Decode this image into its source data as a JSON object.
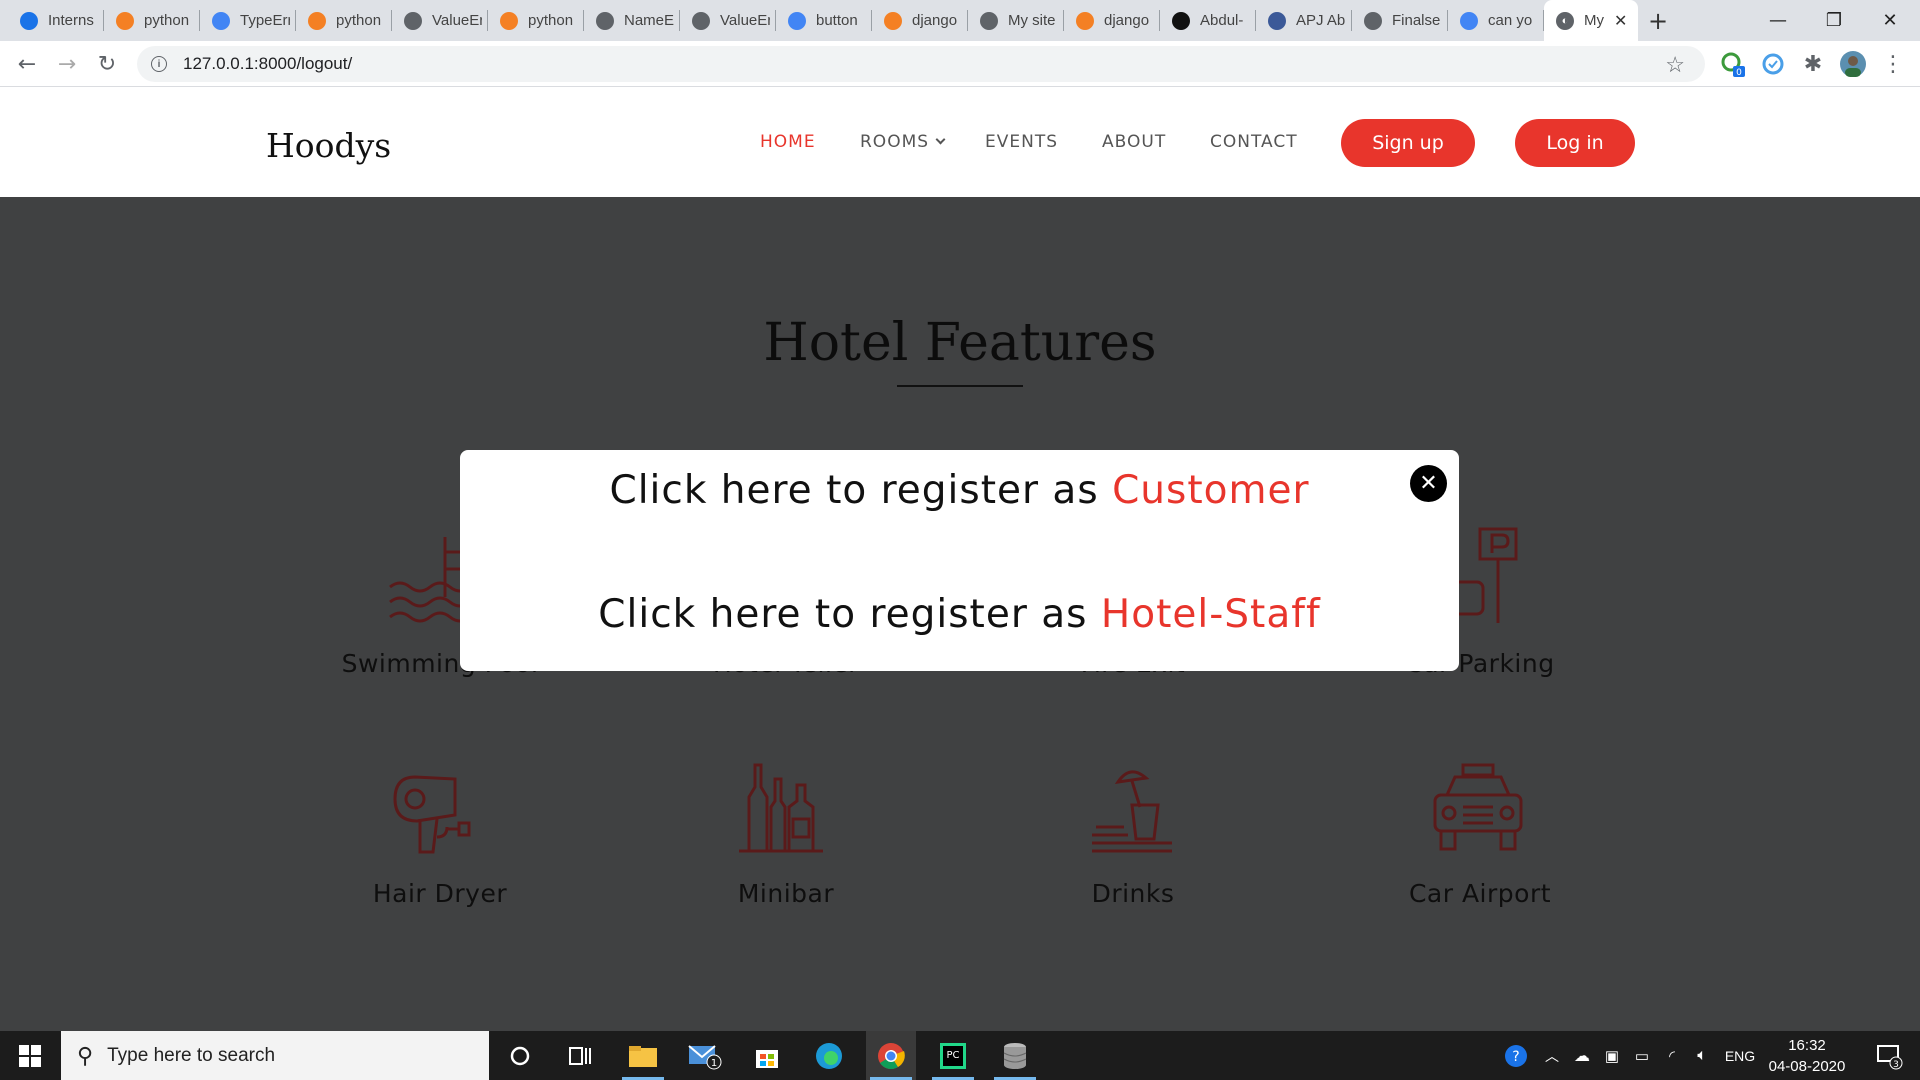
{
  "browser": {
    "tabs": [
      {
        "title": "Interns",
        "favicon": "is-icon",
        "color": "#1a73e8"
      },
      {
        "title": "python",
        "favicon": "stackoverflow-icon",
        "color": "#f48024"
      },
      {
        "title": "TypeErr",
        "favicon": "google-icon",
        "color": "#4285f4"
      },
      {
        "title": "python",
        "favicon": "stackoverflow-icon",
        "color": "#f48024"
      },
      {
        "title": "ValueEr",
        "favicon": "globe-icon",
        "color": "#5f6368"
      },
      {
        "title": "python",
        "favicon": "stackoverflow-icon",
        "color": "#f48024"
      },
      {
        "title": "NameE",
        "favicon": "globe-icon",
        "color": "#5f6368"
      },
      {
        "title": "ValueEr",
        "favicon": "globe-icon",
        "color": "#5f6368"
      },
      {
        "title": "button",
        "favicon": "google-icon",
        "color": "#4285f4"
      },
      {
        "title": "django",
        "favicon": "stackoverflow-icon",
        "color": "#f48024"
      },
      {
        "title": "My site",
        "favicon": "globe-icon",
        "color": "#5f6368"
      },
      {
        "title": "django",
        "favicon": "stackoverflow-icon",
        "color": "#f48024"
      },
      {
        "title": "Abdul-",
        "favicon": "github-icon",
        "color": "#111111"
      },
      {
        "title": "APJ Ab",
        "favicon": "shield-icon",
        "color": "#3b5998"
      },
      {
        "title": "Finalse",
        "favicon": "globe-icon",
        "color": "#5f6368"
      },
      {
        "title": "can yo",
        "favicon": "google-icon",
        "color": "#4285f4"
      }
    ],
    "active_tab": {
      "title": "My",
      "favicon": "globe-icon"
    },
    "url": "127.0.0.1:8000/logout/",
    "extension_badge": "0"
  },
  "site": {
    "brand": "Hoodys",
    "nav": {
      "home": "HOME",
      "rooms": "ROOMS",
      "events": "EVENTS",
      "about": "ABOUT",
      "contact": "CONTACT"
    },
    "signup": "Sign up",
    "login": "Log in",
    "accent_color": "#e8352c",
    "section_title": "Hotel Features",
    "features": [
      {
        "label": "Swimming Pool",
        "icon": "swimming-pool-icon"
      },
      {
        "label": "Hotel Teller",
        "icon": "teller-icon"
      },
      {
        "label": "Fire Exit",
        "icon": "fire-exit-icon"
      },
      {
        "label": "Car Parking",
        "icon": "car-parking-icon"
      },
      {
        "label": "Hair Dryer",
        "icon": "hair-dryer-icon"
      },
      {
        "label": "Minibar",
        "icon": "minibar-icon"
      },
      {
        "label": "Drinks",
        "icon": "drinks-icon"
      },
      {
        "label": "Car Airport",
        "icon": "car-airport-icon"
      }
    ]
  },
  "modal": {
    "line1_prefix": "Click here to register as",
    "line1_link": "Customer",
    "line2_prefix": "Click here to register as",
    "line2_link": "Hotel-Staff",
    "close_glyph": "✕"
  },
  "taskbar": {
    "search_placeholder": "Type here to search",
    "language": "ENG",
    "time": "16:32",
    "date": "04-08-2020",
    "mail_badge": "1",
    "notification_count": "3"
  }
}
